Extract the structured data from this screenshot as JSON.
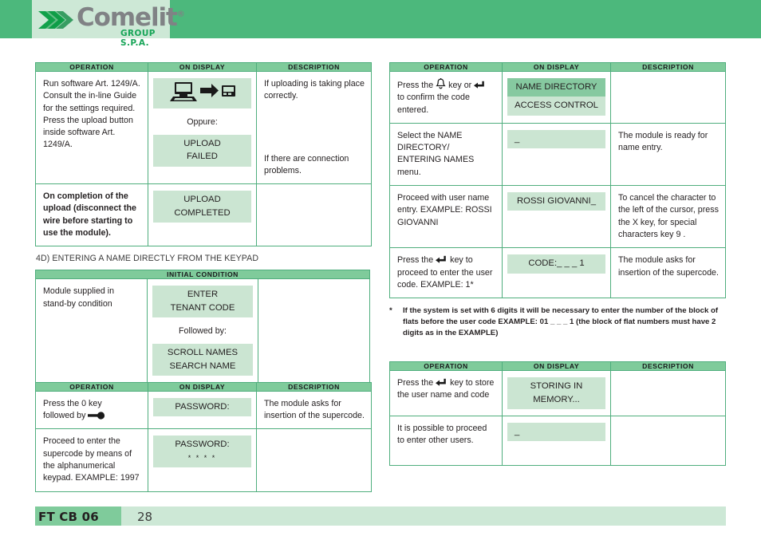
{
  "header": {
    "logo_text": "Comelit",
    "logo_registered": "®",
    "logo_subtitle": "GROUP S.P.A.",
    "logo_mark_icon": "comelit-chevron-logo",
    "band_color": "#4cb87c",
    "panel_color": "#cde8d6"
  },
  "colors": {
    "header_green": "#7fcb9b",
    "display_light": "#cbe5d2",
    "display_dark": "#86c9a0",
    "border_green": "#4fae7d"
  },
  "columns": {
    "operation": "OPERATION",
    "on_display": "ON DISPLAY",
    "description": "DESCRIPTION"
  },
  "left": {
    "table_upload": {
      "rows": [
        {
          "operation": "Run software Art. 1249/A. Consult the in-line Guide for the settings required. Press the upload button inside software Art. 1249/A.",
          "display_icon": "pc-to-module-icon",
          "display_middle": "Oppure:",
          "display_line1": "UPLOAD",
          "display_line2": "FAILED",
          "description_top": "If uploading is taking place correctly.",
          "description_bottom": "If there are connection problems."
        },
        {
          "operation": "On completion of the upload (disconnect the wire before starting to use the module).",
          "display_line1": "UPLOAD",
          "display_line2": "COMPLETED",
          "description": ""
        }
      ]
    },
    "section_title": "4D) ENTERING A NAME DIRECTLY FROM THE KEYPAD",
    "table_initial": {
      "header": "INITIAL CONDITION",
      "operation": "Module supplied in stand-by condition",
      "display_line1": "ENTER",
      "display_line2": "TENANT CODE",
      "display_middle": "Followed by:",
      "display_line3": "SCROLL NAMES",
      "display_line4": "SEARCH NAME",
      "description": ""
    },
    "table_password": {
      "rows": [
        {
          "operation_line1": "Press the 0 key",
          "operation_line2": "followed by",
          "operation_icon": "key-icon",
          "display": "PASSWORD:",
          "description": "The module asks for insertion of the supercode."
        },
        {
          "operation": "Proceed to enter the supercode by means of the alphanumerical keypad. EXAMPLE: 1997",
          "display_line1": "PASSWORD:",
          "display_line2": "* * * *",
          "description": ""
        }
      ]
    }
  },
  "right": {
    "table_name_entry": {
      "rows": [
        {
          "operation_pre": "Press the",
          "operation_icon1": "bell-icon",
          "operation_mid": "key or",
          "operation_icon2": "enter-key-icon",
          "operation_post": "to confirm the code entered.",
          "display_line1": "NAME DIRECTORY",
          "display_line2": "ACCESS CONTROL",
          "description": ""
        },
        {
          "operation": "Select the NAME DIRECTORY/ ENTERING NAMES menu.",
          "display_line1": "_",
          "description": "The module is ready for name entry."
        },
        {
          "operation": "Proceed with user name entry. EXAMPLE: ROSSI GIOVANNI",
          "display_line1": "ROSSI GIOVANNI_",
          "description": "To cancel the character to the left of the cursor, press the X key, for special characters key 9 ."
        },
        {
          "operation_pre": "Press the",
          "operation_icon1": "enter-key-icon",
          "operation_post": "key to proceed to enter the user code. EXAMPLE: 1*",
          "display_line1": "CODE:_ _ _ 1",
          "description": "The module asks for insertion of the supercode."
        }
      ]
    },
    "footnote": {
      "marker": "*",
      "text": "If the system is set with 6 digits it will be necessary to enter the number of the block of flats before the user code EXAMPLE: 01 _ _ _ 1 (the block of flat numbers must have 2 digits as in the EXAMPLE)"
    },
    "table_store": {
      "rows": [
        {
          "operation_pre": "Press the",
          "operation_icon1": "enter-key-icon",
          "operation_post": "key to store the user name and code",
          "display_line1": "STORING IN",
          "display_line2": "MEMORY...",
          "description": ""
        },
        {
          "operation": "It is possible to proceed to enter other users.",
          "display_line1": "_",
          "description": ""
        }
      ]
    }
  },
  "footer": {
    "document_code": "FT CB 06",
    "page_number": "28"
  }
}
